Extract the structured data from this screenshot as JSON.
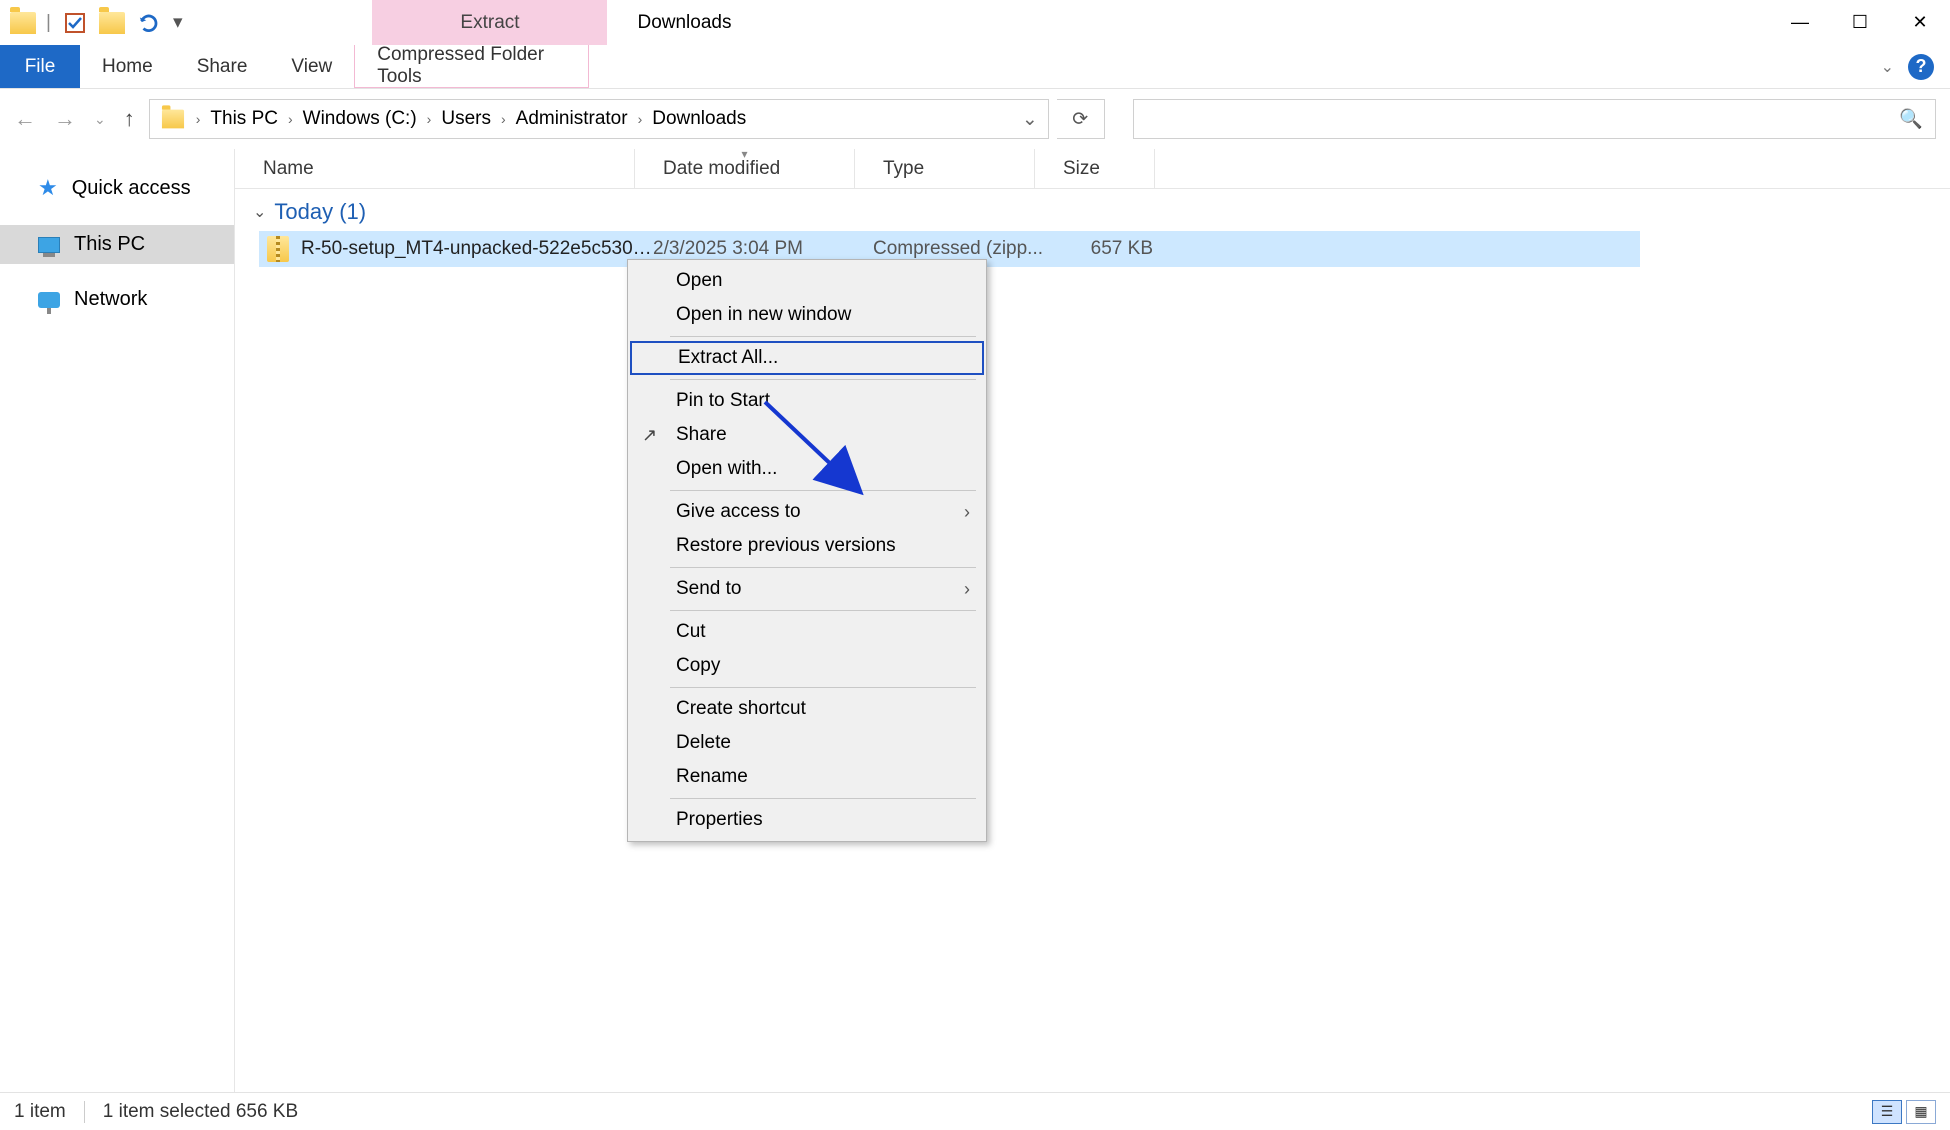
{
  "window": {
    "title": "Downloads"
  },
  "qat": {
    "contextual_tab": "Extract"
  },
  "ribbon": {
    "file": "File",
    "tabs": [
      "Home",
      "Share",
      "View"
    ],
    "contextual": "Compressed Folder Tools"
  },
  "breadcrumb": [
    "This PC",
    "Windows (C:)",
    "Users",
    "Administrator",
    "Downloads"
  ],
  "search": {
    "placeholder": ""
  },
  "sidebar": {
    "items": [
      {
        "label": "Quick access"
      },
      {
        "label": "This PC"
      },
      {
        "label": "Network"
      }
    ]
  },
  "columns": {
    "name": "Name",
    "date": "Date modified",
    "type": "Type",
    "size": "Size"
  },
  "group": {
    "label": "Today (1)"
  },
  "file": {
    "name": "R-50-setup_MT4-unpacked-522e5c5304b...",
    "date": "2/3/2025 3:04 PM",
    "type": "Compressed (zipp...",
    "size": "657 KB"
  },
  "context_menu": {
    "items": [
      {
        "label": "Open"
      },
      {
        "label": "Open in new window"
      },
      {
        "sep": true
      },
      {
        "label": "Extract All...",
        "highlight": true
      },
      {
        "sep": true
      },
      {
        "label": "Pin to Start"
      },
      {
        "label": "Share",
        "icon": "share"
      },
      {
        "label": "Open with..."
      },
      {
        "sep": true
      },
      {
        "label": "Give access to",
        "submenu": true
      },
      {
        "label": "Restore previous versions"
      },
      {
        "sep": true
      },
      {
        "label": "Send to",
        "submenu": true
      },
      {
        "sep": true
      },
      {
        "label": "Cut"
      },
      {
        "label": "Copy"
      },
      {
        "sep": true
      },
      {
        "label": "Create shortcut"
      },
      {
        "label": "Delete"
      },
      {
        "label": "Rename"
      },
      {
        "sep": true
      },
      {
        "label": "Properties"
      }
    ]
  },
  "status": {
    "count": "1 item",
    "selection": "1 item selected  656 KB"
  }
}
